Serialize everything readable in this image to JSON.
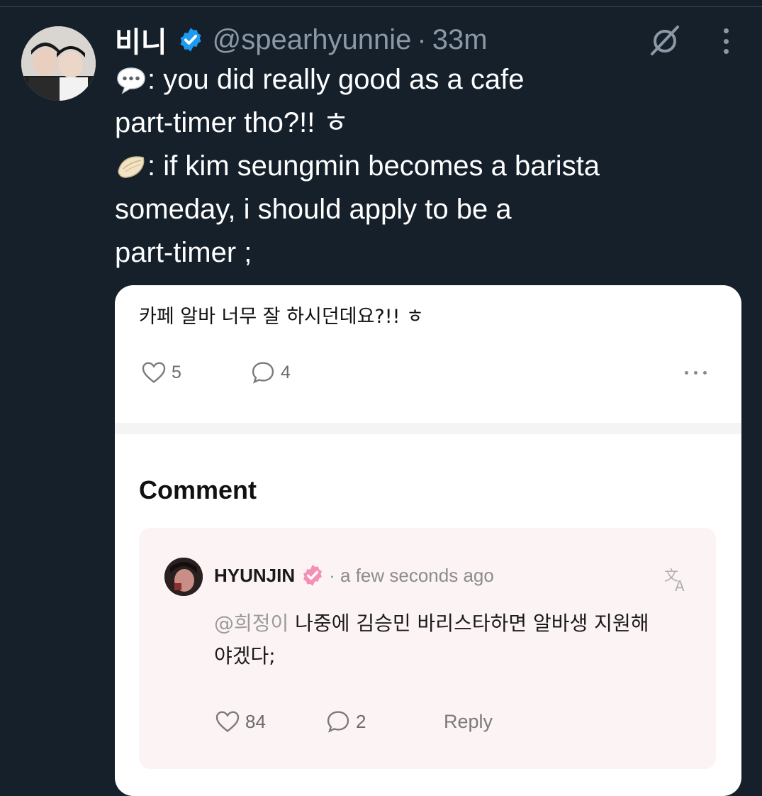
{
  "tweet": {
    "display_name": "비니",
    "handle": "@spearhyunnie",
    "separator": "·",
    "time": "33m",
    "lines": [
      {
        "emoji": "speech-balloon-emoji",
        "text": ": you did really good as a cafe"
      },
      {
        "emoji": "",
        "text": "part-timer tho?!! ㅎ"
      },
      {
        "emoji": "dumpling-emoji",
        "text": ": if kim seungmin becomes a barista"
      },
      {
        "emoji": "",
        "text": "someday, i should apply to be a"
      },
      {
        "emoji": "",
        "text": "part-timer ;"
      }
    ]
  },
  "card": {
    "post_text": "카페 알바 너무 잘 하시던데요?!! ㅎ",
    "likes": "5",
    "comments": "4",
    "comment_heading": "Comment",
    "comment": {
      "author": "HYUNJIN",
      "time": "· a few seconds ago",
      "mention": "@희정이",
      "text_line1": " 나중에 김승민 바리스타하면 알바생 지원해",
      "text_line2": "야겠다;",
      "likes": "84",
      "replies": "2",
      "reply_label": "Reply"
    }
  },
  "colors": {
    "background": "#15202b",
    "verified_blue": "#1d9bf0",
    "badge_pink": "#f58fb4",
    "secondary_text": "#8b98a5"
  }
}
